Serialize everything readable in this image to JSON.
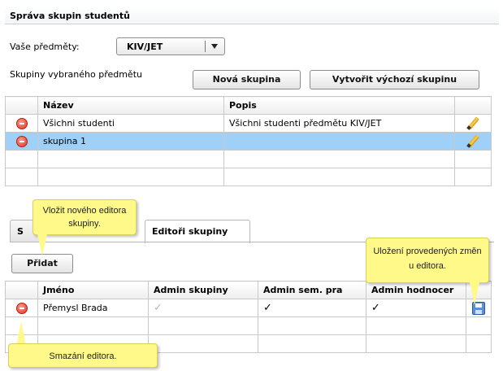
{
  "panel": {
    "title": "Správa skupin studentů"
  },
  "subject": {
    "label": "Vaše předměty:",
    "selected": "KIV/JET"
  },
  "groups": {
    "label": "Skupiny vybraného předmětu",
    "new_button": "Nová skupina",
    "default_button": "Vytvořit výchozí skupinu",
    "columns": [
      "Název",
      "Popis"
    ],
    "rows": [
      {
        "name": "Všichni studenti",
        "description": "Všichni studenti předmětu KIV/JET"
      },
      {
        "name": "skupina 1",
        "description": ""
      }
    ]
  },
  "tabs": [
    {
      "label": "S"
    },
    {
      "label": "Editoři skupiny"
    }
  ],
  "editors": {
    "add_button": "Přidat",
    "columns": [
      "Jméno",
      "Admin skupiny",
      "Admin sem. pra",
      "Admin hodnocer"
    ],
    "rows": [
      {
        "name": "Přemysl Brada",
        "admin_group": true,
        "admin_sem": true,
        "admin_eval": true
      }
    ]
  },
  "callouts": {
    "add_editor": "Vložit nového editora skupiny.",
    "save_changes": "Uložení provedených změn u editora.",
    "delete_editor": "Smazání editora."
  },
  "icons": {
    "remove": "remove-icon",
    "edit": "pencil-icon",
    "save": "save-icon",
    "check": "checkmark-icon",
    "dropdown": "chevron-down-icon"
  },
  "colors": {
    "selected_row": "#9fd0f7",
    "callout": "#fff98a",
    "remove": "#d9352a"
  }
}
